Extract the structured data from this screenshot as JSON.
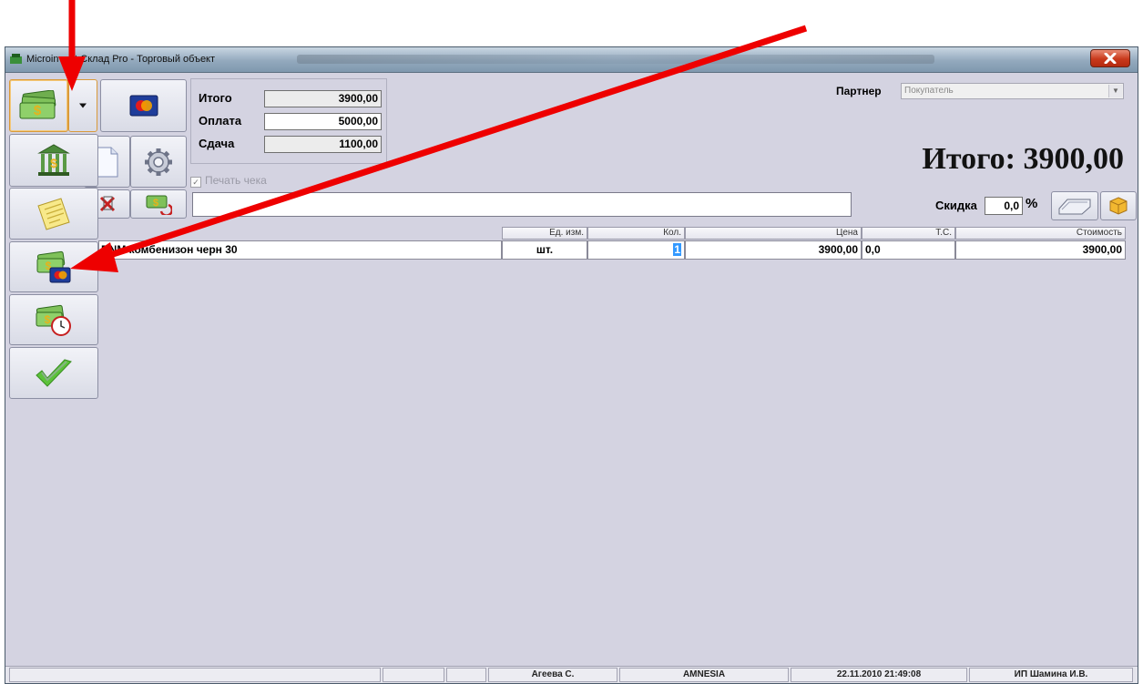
{
  "window": {
    "title": "Microinvent Склад Pro - Торговый объект"
  },
  "totals": {
    "total_label": "Итого",
    "total_value": "3900,00",
    "payment_label": "Оплата",
    "payment_value": "5000,00",
    "change_label": "Сдача",
    "change_value": "1100,00"
  },
  "print_receipt": {
    "label": "Печать чека",
    "checked": true,
    "check_glyph": "✓"
  },
  "partner": {
    "label": "Партнер",
    "value": "Покупатель",
    "arrow_glyph": "▼"
  },
  "big_total": "Итого: 3900,00",
  "discount": {
    "label": "Скидка",
    "value": "0,0",
    "unit": "%"
  },
  "grid": {
    "columns": {
      "unit": "Ед. изм.",
      "qty": "Кол.",
      "price": "Цена",
      "ts": "Т.С.",
      "cost": "Стоимость"
    },
    "rows": [
      {
        "name": "DNM комбенизон черн 30",
        "unit": "шт.",
        "qty": "1",
        "price": "3900,00",
        "ts": "0,0",
        "cost": "3900,00"
      }
    ]
  },
  "statusbar": [
    "",
    "",
    "",
    "Агеева С.",
    "AMNESIA",
    "22.11.2010 21:49:08",
    "ИП Шамина И.В."
  ],
  "icons": {
    "pay_cash": "cash-money-icon",
    "dropdown": "dropdown-arrow-icon",
    "card": "card-payment-icon",
    "bank": "bank-icon",
    "document": "document-icon",
    "settings": "gear-icon",
    "notes": "notepad-icon",
    "delete": "delete-icon",
    "refund": "refund-icon",
    "mixed_payment": "cash-and-card-icon",
    "deferred_payment": "cash-clock-icon",
    "confirm": "checkmark-icon",
    "scanner": "scanner-icon",
    "package": "package-icon",
    "close": "close-icon"
  },
  "colors": {
    "window_bg": "#d4d3e1",
    "annotation_arrow": "#ee0000",
    "selection": "#3399ff",
    "close_button": "#c8391b"
  }
}
